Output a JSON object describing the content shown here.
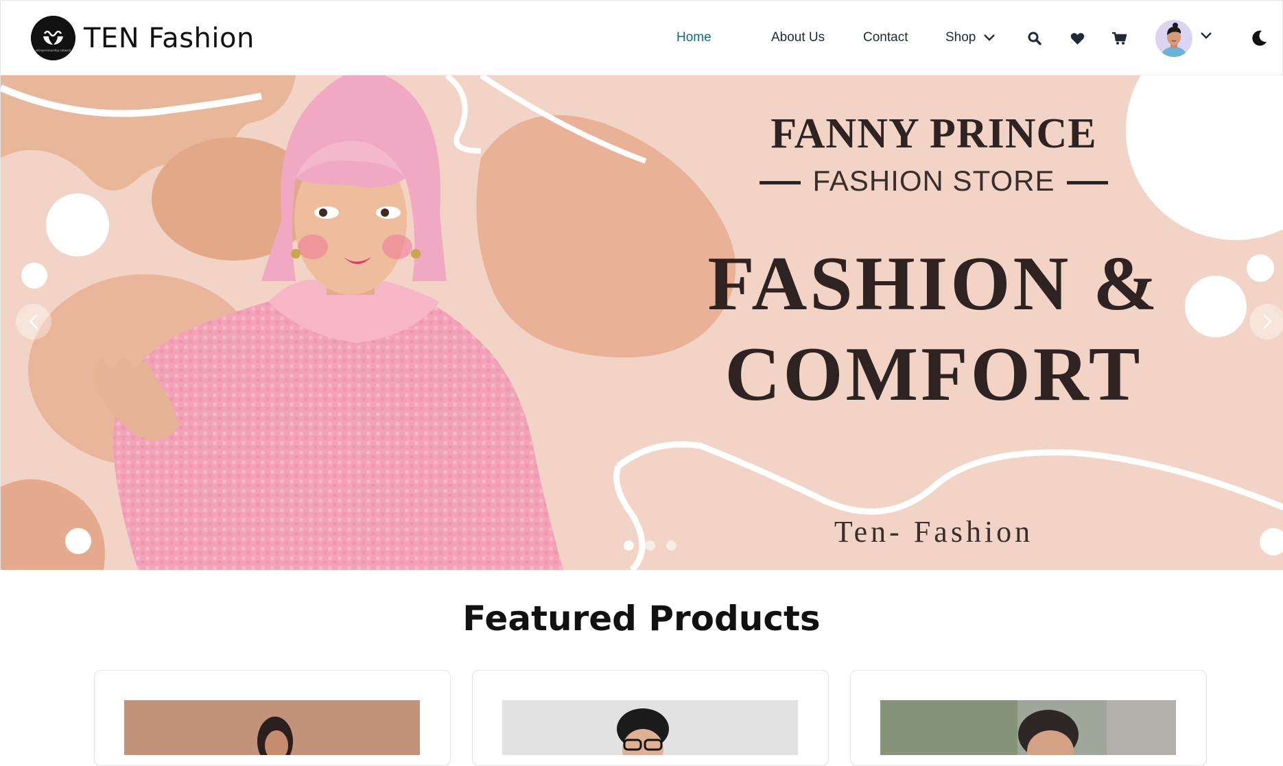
{
  "brand": {
    "name": "TEN Fashion",
    "logo_icon": "hands-infinity-logo"
  },
  "nav": {
    "home": "Home",
    "about": "About Us",
    "contact": "Contact",
    "shop": "Shop",
    "icons": [
      "search-icon",
      "heart-icon",
      "cart-icon",
      "avatar",
      "chevron-down-icon",
      "moon-icon"
    ],
    "active": "Home",
    "active_color": "#0d6b8a"
  },
  "hero": {
    "brand_line": "FANNY PRINCE",
    "sub_line": "FASHION STORE",
    "headline_1": "FASHION &",
    "headline_2": "COMFORT",
    "tagline": "Ten- Fashion",
    "background_color": "#f2d4c6",
    "active_slide": 1,
    "slide_count": 3
  },
  "featured": {
    "title": "Featured Products"
  }
}
